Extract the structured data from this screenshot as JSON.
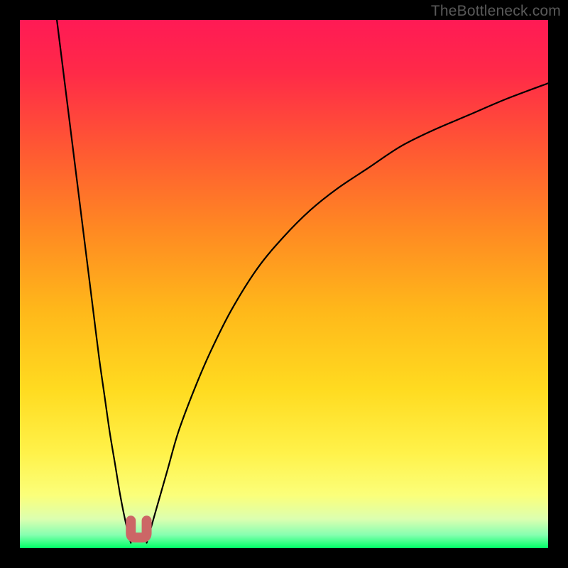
{
  "watermark": "TheBottleneck.com",
  "colors": {
    "frame_bg": "#000000",
    "curve": "#000000",
    "marker": "#cc6666",
    "green_band": "#00ff55"
  },
  "gradient_stops": [
    {
      "offset": 0.0,
      "color": "#ff1a55"
    },
    {
      "offset": 0.1,
      "color": "#ff2a48"
    },
    {
      "offset": 0.25,
      "color": "#ff5a32"
    },
    {
      "offset": 0.4,
      "color": "#ff8a22"
    },
    {
      "offset": 0.55,
      "color": "#ffb81a"
    },
    {
      "offset": 0.7,
      "color": "#ffdb20"
    },
    {
      "offset": 0.82,
      "color": "#fff24a"
    },
    {
      "offset": 0.9,
      "color": "#fbff7a"
    },
    {
      "offset": 0.945,
      "color": "#dcffb0"
    },
    {
      "offset": 0.975,
      "color": "#86ffb0"
    },
    {
      "offset": 1.0,
      "color": "#00ff66"
    }
  ],
  "chart_data": {
    "type": "line",
    "title": "",
    "xlabel": "",
    "ylabel": "",
    "xlim": [
      0,
      100
    ],
    "ylim": [
      0,
      100
    ],
    "x_min_curve1": 21,
    "x_min_curve2": 24,
    "curve1_note": "steep descending branch from top-left to minimum near x≈21",
    "curve2_note": "rising branch from minimum near x≈24 asymptotically toward ~90%",
    "marker": {
      "x_range": [
        21,
        24
      ],
      "y": 2,
      "shape": "u"
    },
    "series": [
      {
        "name": "left-branch",
        "x": [
          7,
          8,
          9,
          10,
          11,
          12,
          13,
          14,
          15,
          16,
          17,
          18,
          19,
          20,
          21
        ],
        "y": [
          100,
          92,
          84,
          76,
          68,
          60,
          52,
          44,
          36,
          29,
          22,
          16,
          10,
          5,
          1
        ]
      },
      {
        "name": "right-branch",
        "x": [
          24,
          26,
          28,
          30,
          33,
          36,
          40,
          45,
          50,
          55,
          60,
          66,
          72,
          78,
          85,
          92,
          100
        ],
        "y": [
          1,
          8,
          15,
          22,
          30,
          37,
          45,
          53,
          59,
          64,
          68,
          72,
          76,
          79,
          82,
          85,
          88
        ]
      }
    ]
  }
}
